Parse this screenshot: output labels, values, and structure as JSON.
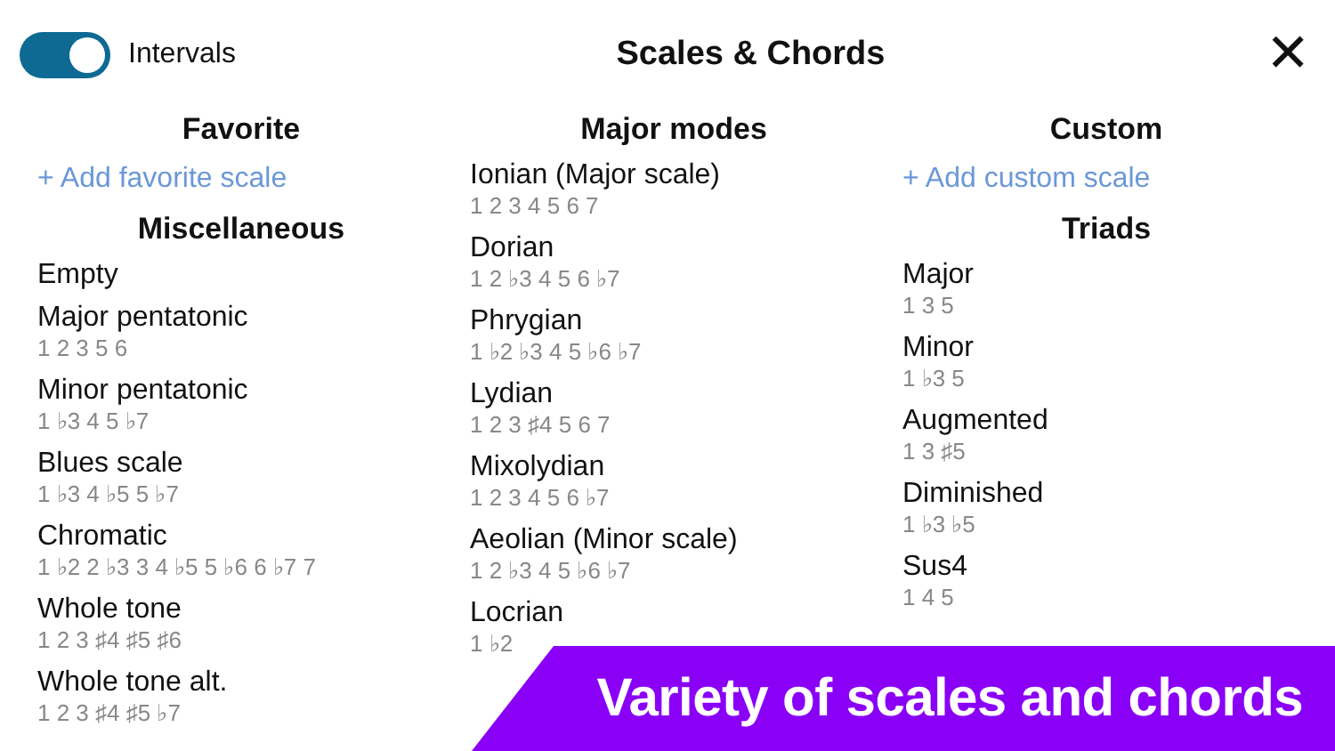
{
  "header": {
    "toggle": {
      "label": "Intervals",
      "on": true
    },
    "title": "Scales & Chords",
    "close": "✕"
  },
  "columns": [
    {
      "sections": [
        {
          "title": "Favorite",
          "add_link": "+ Add favorite scale"
        },
        {
          "title": "Miscellaneous",
          "items": [
            {
              "name": "Empty"
            },
            {
              "name": "Major pentatonic",
              "intervals": "1 2 3 5 6"
            },
            {
              "name": "Minor pentatonic",
              "intervals": "1 ♭3 4 5 ♭7"
            },
            {
              "name": "Blues scale",
              "intervals": "1 ♭3 4 ♭5 5 ♭7"
            },
            {
              "name": "Chromatic",
              "intervals": "1 ♭2 2 ♭3 3 4 ♭5 5 ♭6 6 ♭7 7"
            },
            {
              "name": "Whole tone",
              "intervals": "1 2 3 ♯4 ♯5 ♯6"
            },
            {
              "name": "Whole tone alt.",
              "intervals": "1 2 3 ♯4 ♯5 ♭7"
            }
          ]
        }
      ]
    },
    {
      "sections": [
        {
          "title": "Major modes",
          "items": [
            {
              "name": "Ionian (Major scale)",
              "intervals": "1 2 3 4 5 6 7"
            },
            {
              "name": "Dorian",
              "intervals": "1 2 ♭3 4 5 6 ♭7"
            },
            {
              "name": "Phrygian",
              "intervals": "1 ♭2 ♭3 4 5 ♭6 ♭7"
            },
            {
              "name": "Lydian",
              "intervals": "1 2 3 ♯4 5 6 7"
            },
            {
              "name": "Mixolydian",
              "intervals": "1 2 3 4 5 6 ♭7"
            },
            {
              "name": "Aeolian (Minor scale)",
              "intervals": "1 2 ♭3 4 5 ♭6 ♭7"
            },
            {
              "name": "Locrian",
              "intervals": "1 ♭2"
            }
          ]
        }
      ]
    },
    {
      "sections": [
        {
          "title": "Custom",
          "add_link": "+ Add custom scale"
        },
        {
          "title": "Triads",
          "items": [
            {
              "name": "Major",
              "intervals": "1 3 5"
            },
            {
              "name": "Minor",
              "intervals": "1 ♭3 5"
            },
            {
              "name": "Augmented",
              "intervals": "1 3 ♯5"
            },
            {
              "name": "Diminished",
              "intervals": "1 ♭3 ♭5"
            },
            {
              "name": "Sus4",
              "intervals": "1 4 5"
            }
          ]
        }
      ]
    }
  ],
  "banner": {
    "text": "Variety of scales and chords"
  }
}
